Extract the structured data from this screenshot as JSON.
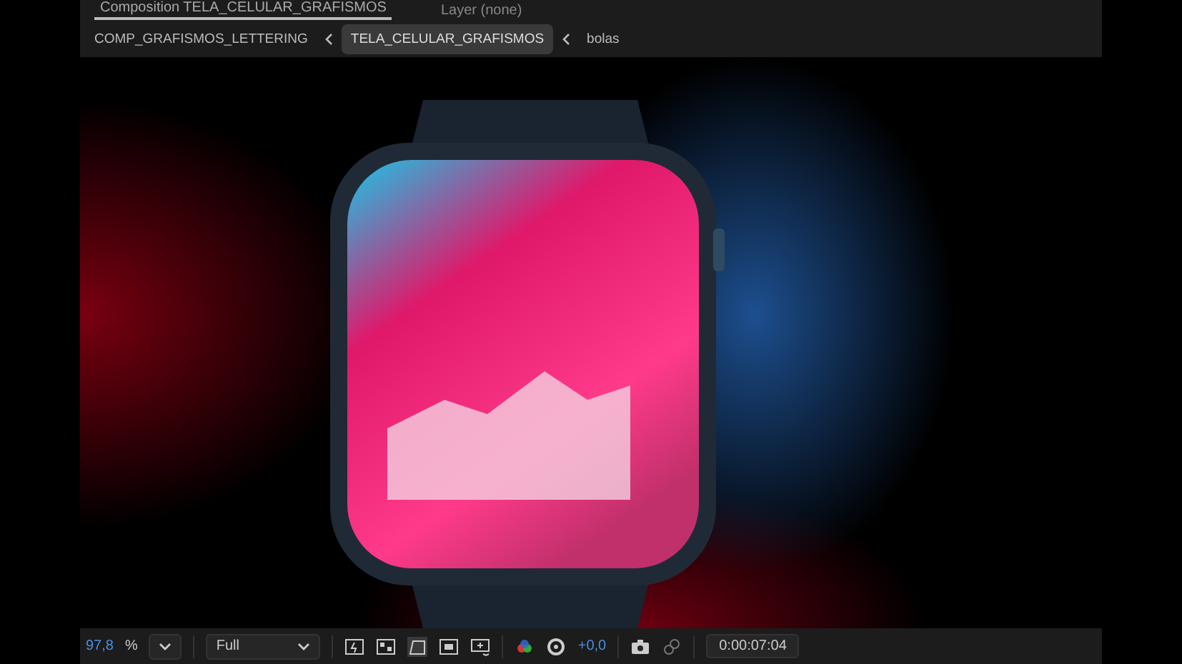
{
  "panel_tabs": [
    {
      "label": "Composition TELA_CELULAR_GRAFISMOS",
      "selected": true
    },
    {
      "label": "Layer (none)",
      "selected": false
    }
  ],
  "breadcrumbs": [
    {
      "label": "COMP_GRAFISMOS_LETTERING",
      "selected": false
    },
    {
      "label": "TELA_CELULAR_GRAFISMOS",
      "selected": true
    },
    {
      "label": "bolas",
      "selected": false
    }
  ],
  "toolbar": {
    "zoom": "97,8",
    "zoom_unit": "%",
    "resolution": "Full",
    "exposure": "+0,0",
    "timecode": "0:00:07:04"
  }
}
